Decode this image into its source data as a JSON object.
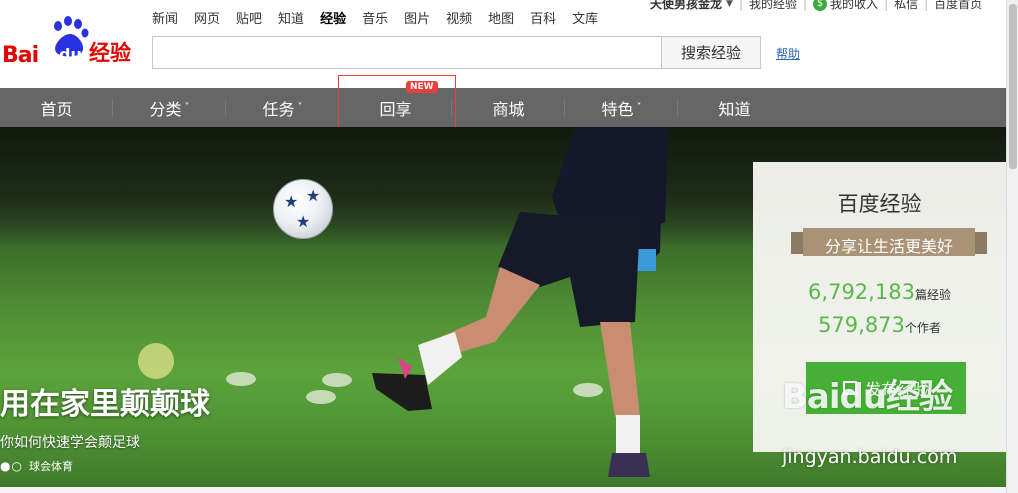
{
  "logo": {
    "text_bai": "Bai",
    "text_du": "du",
    "text_jingyan": "经验"
  },
  "topnav": {
    "items": [
      {
        "label": "新闻",
        "active": false
      },
      {
        "label": "网页",
        "active": false
      },
      {
        "label": "贴吧",
        "active": false
      },
      {
        "label": "知道",
        "active": false
      },
      {
        "label": "经验",
        "active": true
      },
      {
        "label": "音乐",
        "active": false
      },
      {
        "label": "图片",
        "active": false
      },
      {
        "label": "视频",
        "active": false
      },
      {
        "label": "地图",
        "active": false
      },
      {
        "label": "百科",
        "active": false
      },
      {
        "label": "文库",
        "active": false
      }
    ]
  },
  "userbar": {
    "username": "天使男孩金龙",
    "my_experience": "我的经验",
    "my_income": "我的收入",
    "messages": "私信",
    "baidu_home": "百度首页"
  },
  "search": {
    "value": "",
    "button_label": "搜索经验",
    "help_label": "帮助"
  },
  "mainnav": {
    "items": [
      {
        "label": "首页",
        "has_dropdown": false
      },
      {
        "label": "分类",
        "has_dropdown": true
      },
      {
        "label": "任务",
        "has_dropdown": true
      },
      {
        "label": "回享",
        "has_dropdown": false
      },
      {
        "label": "商城",
        "has_dropdown": false
      },
      {
        "label": "特色",
        "has_dropdown": true
      },
      {
        "label": "知道",
        "has_dropdown": false
      }
    ],
    "new_badge": "NEW",
    "badge_color": "#e8403a"
  },
  "hero": {
    "title": "用在家里颠颠球",
    "subtitle": "你如何快速学会颠足球",
    "source": "球会体育"
  },
  "panel": {
    "title": "百度经验",
    "slogan": "分享让生活更美好",
    "experience_count": "6,792,183",
    "experience_unit": "篇经验",
    "author_count": "579,873",
    "author_unit": "个作者",
    "publish_label": "发布经验",
    "accent_color": "#45b035"
  },
  "watermark": {
    "logo": "Baidu经验",
    "url": "jingyan.baidu.com"
  }
}
